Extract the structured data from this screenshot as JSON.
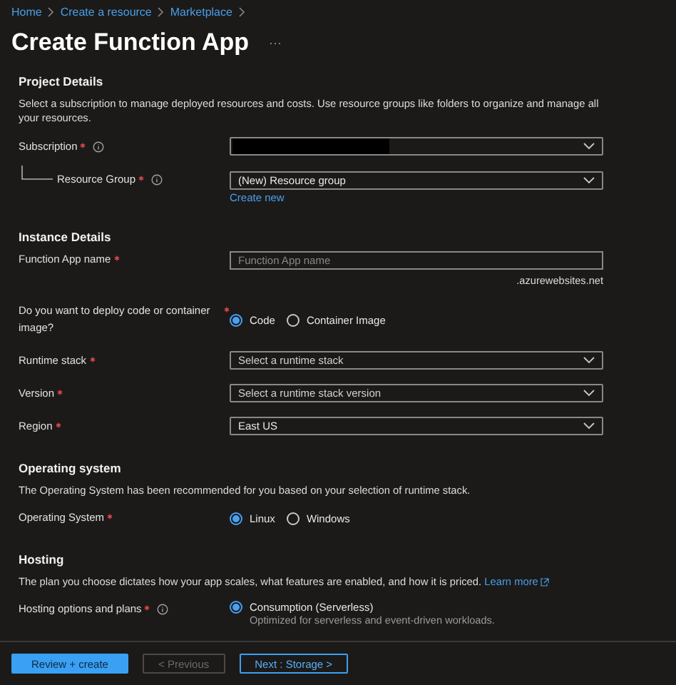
{
  "breadcrumb": [
    {
      "label": "Home"
    },
    {
      "label": "Create a resource"
    },
    {
      "label": "Marketplace"
    }
  ],
  "title": "Create Function App",
  "more": "···",
  "sections": [
    {
      "heading": "Project Details",
      "description": "Select a subscription to manage deployed resources and costs. Use resource groups like folders to organize and manage all your resources.",
      "fields": [
        {
          "kind": "dropdown",
          "label": "Subscription",
          "required": true,
          "info": true,
          "redacted": true,
          "children": [
            {
              "kind": "dropdown",
              "label": "Resource Group",
              "required": true,
              "info": true,
              "value": "(New) Resource group",
              "link": "Create new"
            }
          ]
        }
      ]
    },
    {
      "heading": "Instance Details",
      "fields": [
        {
          "kind": "text",
          "label": "Function App name",
          "required": true,
          "placeholder": "Function App name",
          "hint": ".azurewebsites.net"
        },
        {
          "kind": "radio",
          "label": "Do you want to deploy code or container image?",
          "required": true,
          "options": [
            {
              "label": "Code",
              "selected": true
            },
            {
              "label": "Container Image",
              "selected": false
            }
          ]
        },
        {
          "kind": "dropdown",
          "label": "Runtime stack",
          "required": true,
          "placeholder": "Select a runtime stack"
        },
        {
          "kind": "dropdown",
          "label": "Version",
          "required": true,
          "placeholder": "Select a runtime stack version"
        },
        {
          "kind": "dropdown",
          "label": "Region",
          "required": true,
          "value": "East US"
        }
      ]
    },
    {
      "heading": "Operating system",
      "description": "The Operating System has been recommended for you based on your selection of runtime stack.",
      "fields": [
        {
          "kind": "radio",
          "label": "Operating System",
          "required": true,
          "options": [
            {
              "label": "Linux",
              "selected": true
            },
            {
              "label": "Windows",
              "selected": false
            }
          ]
        }
      ]
    },
    {
      "heading": "Hosting",
      "description": "The plan you choose dictates how your app scales, what features are enabled, and how it is priced.",
      "learn_more": "Learn more",
      "fields": [
        {
          "kind": "radio",
          "label": "Hosting options and plans",
          "required": true,
          "info": true,
          "options": [
            {
              "label": "Consumption (Serverless)",
              "selected": true,
              "description": "Optimized for serverless and event-driven workloads."
            }
          ]
        }
      ]
    }
  ],
  "buttons": [
    {
      "label": "Review + create",
      "kind": "primary",
      "disabled": false
    },
    {
      "label": "< Previous",
      "kind": "secondary",
      "disabled": true
    },
    {
      "label": "Next : Storage >",
      "kind": "outline",
      "disabled": false
    }
  ]
}
